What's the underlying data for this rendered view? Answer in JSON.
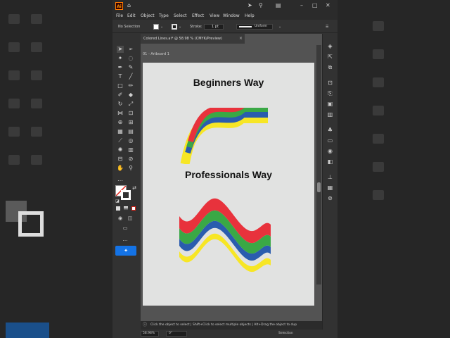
{
  "menu": [
    "File",
    "Edit",
    "Object",
    "Type",
    "Select",
    "Effect",
    "View",
    "Window",
    "Help"
  ],
  "control_bar": {
    "selection": "No Selection",
    "stroke_label": "Stroke:",
    "stroke_value": "1 pt",
    "profile": "Uniform"
  },
  "tab": {
    "label": "Colored Lines.ai* @ 58.98 % (CMYK/Preview)",
    "close": "×"
  },
  "artboard": {
    "label": "01 - Artboard 1",
    "heading_top": "Beginners Way",
    "heading_bottom": "Professionals Way"
  },
  "ribbon_colors": {
    "red": "#e8323c",
    "green": "#3aa845",
    "blue": "#2a5cae",
    "yellow": "#f7e625"
  },
  "status": {
    "hint": "Click the object to select  |  Shift+Click to select multiple objects  |  Alt+Drag the object to dup",
    "zoom": "58.98%",
    "rotation": "0°",
    "tool": "Selection"
  },
  "icons": {
    "logo": "Ai",
    "home": "home-icon",
    "search": "search-icon"
  }
}
